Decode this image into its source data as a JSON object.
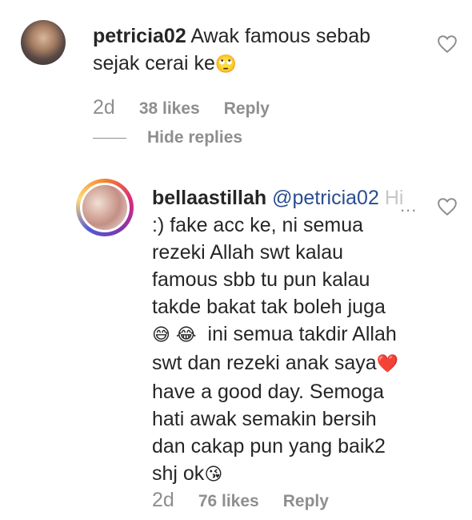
{
  "comment": {
    "username": "petricia02",
    "text_line1": "Awak famous sebab",
    "text_line2": "sejak cerai ke",
    "emoji": "🙄",
    "time": "2d",
    "likes": "38 likes",
    "reply_label": "Reply",
    "hide_replies_label": "Hide replies"
  },
  "reply": {
    "username": "bellaastillah",
    "mention": "@petricia02",
    "faded_text": "Hi",
    "more": "...",
    "line1": ":) fake acc ke, ni semua",
    "line2": "rezeki Allah swt kalau",
    "line3": "famous sbb tu pun kalau",
    "line4": "takde bakat tak boleh juga",
    "line5_emoji1": "😅",
    "line5_emoji2": "😂",
    "line5_text": "ini semua takdir Allah",
    "line6_text": "swt dan rezeki anak saya",
    "line6_emoji": "❤️",
    "line7": "have a good day. Semoga",
    "line8": "hati awak semakin bersih",
    "line9": "dan cakap pun yang baik2",
    "line10_text": "shj ok",
    "line10_emoji": "😘",
    "time": "2d",
    "likes": "76 likes",
    "reply_label": "Reply"
  }
}
